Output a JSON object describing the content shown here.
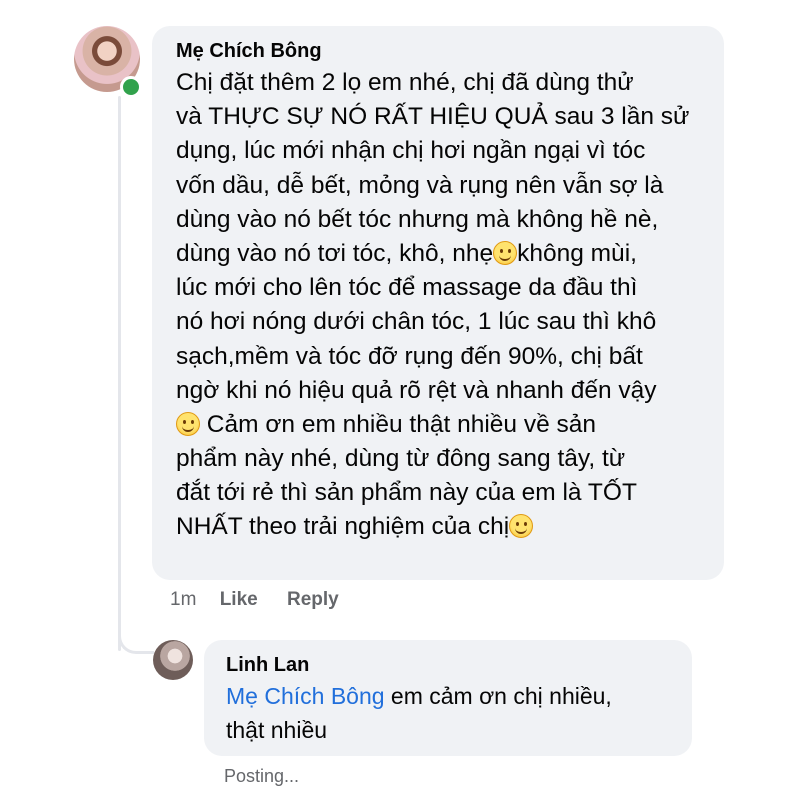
{
  "comment": {
    "author": "Mẹ Chích Bông",
    "lines": [
      "Chị đặt thêm 2 lọ em nhé, chị đã dùng thử",
      "và THỰC SỰ NÓ RẤT HIỆU QUẢ sau 3 lần sử",
      "dụng, lúc mới nhận chị hơi ngần ngại vì tóc",
      "vốn dầu, dễ bết, mỏng và rụng nên vẫn sợ là",
      "dùng vào nó bết tóc nhưng mà không hề nè,",
      "dùng vào nó tơi tóc, khô, nhẹ",
      "không mùi,",
      "lúc mới cho lên tóc để massage da đầu thì",
      "nó hơi nóng dưới chân tóc, 1 lúc sau thì khô",
      "sạch,mềm và tóc đỡ rụng đến 90%, chị bất",
      "ngờ khi nó hiệu quả rõ rệt và nhanh đến vậy",
      " Cảm ơn em nhiều thật nhiều về sản",
      "phẩm này nhé, dùng từ đông sang tây, từ",
      "đắt tới rẻ thì sản phẩm này của em là TỐT",
      "NHẤT theo trải nghiệm của chị"
    ],
    "time": "1m",
    "like_label": "Like",
    "reply_label": "Reply",
    "emoji_icon": "smiling-face-emoji"
  },
  "reply": {
    "author": "Linh Lan",
    "mention": "Mẹ Chích Bông",
    "text_after_mention": " em cảm ơn chị nhiều,",
    "line2": "thật nhiều",
    "status": "Posting..."
  },
  "colors": {
    "bubble": "#f0f2f5",
    "online": "#31a24c",
    "mention": "#216fdb",
    "secondary_text": "#65676b"
  }
}
